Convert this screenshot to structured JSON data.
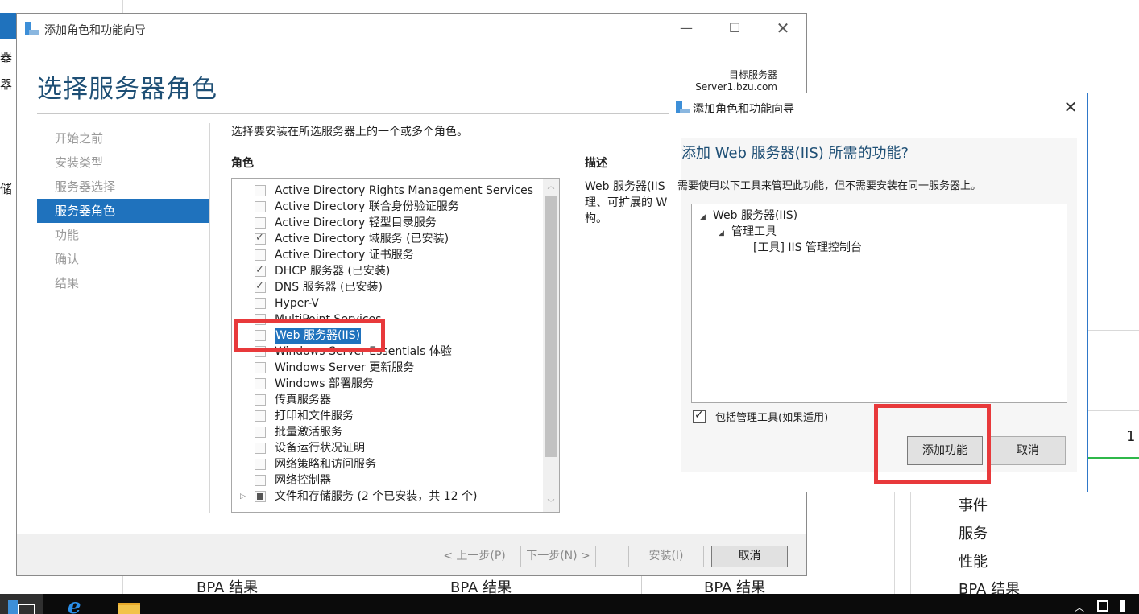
{
  "background": {
    "side_items": [
      "器",
      "器",
      "储"
    ],
    "right_list": [
      "事件",
      "服务",
      "性能",
      "BPA 结果"
    ],
    "bpa_labels": [
      "BPA 结果",
      "BPA 结果",
      "BPA 结果"
    ],
    "count": "1"
  },
  "wizard": {
    "title": "添加角色和功能向导",
    "page_title": "选择服务器角色",
    "target_label": "目标服务器",
    "target_value": "Server1.bzu.com",
    "nav": [
      {
        "label": "开始之前",
        "active": false
      },
      {
        "label": "安装类型",
        "active": false
      },
      {
        "label": "服务器选择",
        "active": false
      },
      {
        "label": "服务器角色",
        "active": true
      },
      {
        "label": "功能",
        "active": false
      },
      {
        "label": "确认",
        "active": false
      },
      {
        "label": "结果",
        "active": false
      }
    ],
    "instruction": "选择要安装在所选服务器上的一个或多个角色。",
    "roles_header": "角色",
    "description_header": "描述",
    "description_text": "Web 服务器(IIS 理、可扩展的 W 构。",
    "roles": [
      {
        "label": "Active Directory Rights Management Services",
        "state": "unchecked"
      },
      {
        "label": "Active Directory 联合身份验证服务",
        "state": "unchecked"
      },
      {
        "label": "Active Directory 轻型目录服务",
        "state": "unchecked"
      },
      {
        "label": "Active Directory 域服务 (已安装)",
        "state": "checked"
      },
      {
        "label": "Active Directory 证书服务",
        "state": "unchecked"
      },
      {
        "label": "DHCP 服务器 (已安装)",
        "state": "checked"
      },
      {
        "label": "DNS 服务器 (已安装)",
        "state": "checked"
      },
      {
        "label": "Hyper-V",
        "state": "unchecked"
      },
      {
        "label": "MultiPoint Services",
        "state": "unchecked"
      },
      {
        "label": "Web 服务器(IIS)",
        "state": "unchecked",
        "selected": true
      },
      {
        "label": "Windows Server Essentials 体验",
        "state": "unchecked"
      },
      {
        "label": "Windows Server 更新服务",
        "state": "unchecked"
      },
      {
        "label": "Windows 部署服务",
        "state": "unchecked"
      },
      {
        "label": "传真服务器",
        "state": "unchecked"
      },
      {
        "label": "打印和文件服务",
        "state": "unchecked"
      },
      {
        "label": "批量激活服务",
        "state": "unchecked"
      },
      {
        "label": "设备运行状况证明",
        "state": "unchecked"
      },
      {
        "label": "网络策略和访问服务",
        "state": "unchecked"
      },
      {
        "label": "网络控制器",
        "state": "unchecked"
      },
      {
        "label": "文件和存储服务 (2 个已安装，共 12 个)",
        "state": "partial",
        "expandable": true
      }
    ],
    "buttons": {
      "prev": "< 上一步(P)",
      "next": "下一步(N) >",
      "install": "安装(I)",
      "cancel": "取消"
    }
  },
  "dialog": {
    "title": "添加角色和功能向导",
    "heading": "添加 Web 服务器(IIS) 所需的功能?",
    "description": "需要使用以下工具来管理此功能，但不需要安装在同一服务器上。",
    "tree": [
      {
        "label": "Web 服务器(IIS)",
        "level": 0,
        "arrow": true
      },
      {
        "label": "管理工具",
        "level": 1,
        "arrow": true
      },
      {
        "label": "[工具] IIS 管理控制台",
        "level": 2,
        "arrow": false
      }
    ],
    "checkbox_label": "包括管理工具(如果适用)",
    "checkbox_checked": true,
    "buttons": {
      "add": "添加功能",
      "cancel": "取消"
    }
  },
  "colors": {
    "accent": "#1f72bd",
    "title": "#1e4f75",
    "highlight_box": "#e8393b"
  }
}
